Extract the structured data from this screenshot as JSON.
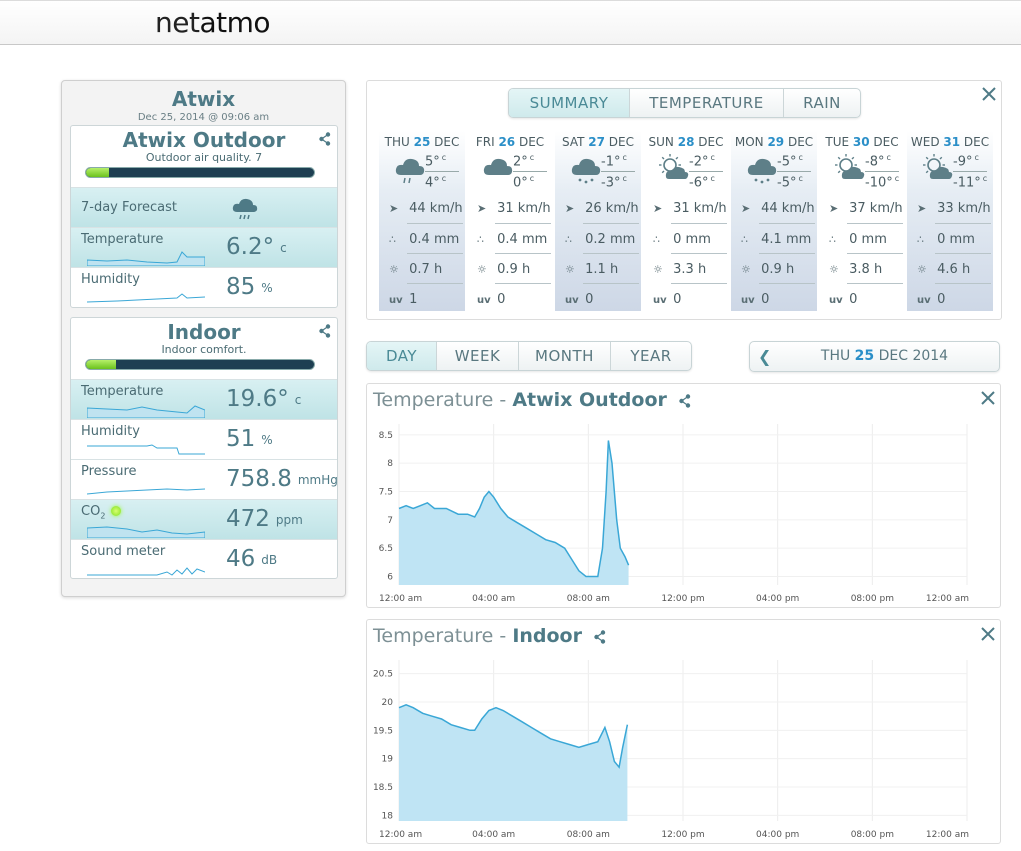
{
  "app": {
    "logo_light": "net",
    "logo_bold": "atmo"
  },
  "station": {
    "name": "Atwix",
    "date": "Dec 25, 2014 @ 09:06 am",
    "outdoor": {
      "title": "Atwix Outdoor",
      "subtitle": "Outdoor air quality. 7",
      "quality_fraction": 0.1,
      "rows": {
        "forecast": "7-day Forecast",
        "temperature": {
          "label": "Temperature",
          "value": "6.2°",
          "unit": "c"
        },
        "humidity": {
          "label": "Humidity",
          "value": "85",
          "unit": "%"
        }
      }
    },
    "indoor": {
      "title": "Indoor",
      "subtitle": "Indoor comfort.",
      "comfort_fraction": 0.13,
      "rows": {
        "temperature": {
          "label": "Temperature",
          "value": "19.6°",
          "unit": "c"
        },
        "humidity": {
          "label": "Humidity",
          "value": "51",
          "unit": "%"
        },
        "pressure": {
          "label": "Pressure",
          "value": "758.8",
          "unit": "mmHg"
        },
        "co2": {
          "label": "CO",
          "sub": "2",
          "value": "472",
          "unit": "ppm"
        },
        "sound": {
          "label": "Sound meter",
          "value": "46",
          "unit": "dB"
        }
      }
    }
  },
  "forecast": {
    "tabs": [
      "SUMMARY",
      "TEMPERATURE",
      "RAIN"
    ],
    "days": [
      {
        "dow": "THU",
        "num": "25",
        "mon": "DEC",
        "icon": "rain-icon",
        "max": "5°",
        "min": "4°",
        "wind": "44 km/h",
        "rain": "0.4 mm",
        "sun": "0.7 h",
        "uv": "1"
      },
      {
        "dow": "FRI",
        "num": "26",
        "mon": "DEC",
        "icon": "cloud-icon",
        "max": "2°",
        "min": "0°",
        "wind": "31 km/h",
        "rain": "0.4 mm",
        "sun": "0.9 h",
        "uv": "0"
      },
      {
        "dow": "SAT",
        "num": "27",
        "mon": "DEC",
        "icon": "snow-icon",
        "max": "-1°",
        "min": "-3°",
        "wind": "26 km/h",
        "rain": "0.2 mm",
        "sun": "1.1 h",
        "uv": "0"
      },
      {
        "dow": "SUN",
        "num": "28",
        "mon": "DEC",
        "icon": "sun-cloud-icon",
        "max": "-2°",
        "min": "-6°",
        "wind": "31 km/h",
        "rain": "0 mm",
        "sun": "3.3 h",
        "uv": "0"
      },
      {
        "dow": "MON",
        "num": "29",
        "mon": "DEC",
        "icon": "snow-icon",
        "max": "-5°",
        "min": "-5°",
        "wind": "44 km/h",
        "rain": "4.1 mm",
        "sun": "0.9 h",
        "uv": "0"
      },
      {
        "dow": "TUE",
        "num": "30",
        "mon": "DEC",
        "icon": "sun-cloud-icon",
        "max": "-8°",
        "min": "-10°",
        "wind": "37 km/h",
        "rain": "0 mm",
        "sun": "3.8 h",
        "uv": "0"
      },
      {
        "dow": "WED",
        "num": "31",
        "mon": "DEC",
        "icon": "sun-cloud-icon",
        "max": "-9°",
        "min": "-11°",
        "wind": "33 km/h",
        "rain": "0 mm",
        "sun": "4.6 h",
        "uv": "0"
      }
    ],
    "unit": "c",
    "uv_label": "uv"
  },
  "range": {
    "tabs": [
      "DAY",
      "WEEK",
      "MONTH",
      "YEAR"
    ],
    "date_pre": "THU",
    "date_num": "25",
    "date_post": "DEC 2014"
  },
  "chart_data": [
    {
      "type": "area",
      "title_prefix": "Temperature -",
      "title_bold": "Atwix Outdoor",
      "ylim": [
        5.85,
        8.55
      ],
      "yticks": [
        "8.5",
        "8",
        "7.5",
        "7",
        "6.5",
        "6"
      ],
      "ytick_values": [
        8.5,
        8,
        7.5,
        7,
        6.5,
        6
      ],
      "xticks": [
        "12:00 am",
        "04:00 am",
        "08:00 am",
        "12:00 pm",
        "04:00 pm",
        "08:00 pm",
        "12:00 am"
      ],
      "xlim": [
        0,
        24
      ],
      "points": [
        [
          0,
          7.2
        ],
        [
          0.3,
          7.25
        ],
        [
          0.6,
          7.2
        ],
        [
          0.9,
          7.25
        ],
        [
          1.2,
          7.3
        ],
        [
          1.5,
          7.2
        ],
        [
          2.0,
          7.2
        ],
        [
          2.5,
          7.1
        ],
        [
          2.9,
          7.1
        ],
        [
          3.2,
          7.05
        ],
        [
          3.4,
          7.2
        ],
        [
          3.6,
          7.4
        ],
        [
          3.8,
          7.5
        ],
        [
          4.0,
          7.4
        ],
        [
          4.3,
          7.2
        ],
        [
          4.6,
          7.05
        ],
        [
          5.0,
          6.95
        ],
        [
          5.4,
          6.85
        ],
        [
          5.8,
          6.75
        ],
        [
          6.2,
          6.65
        ],
        [
          6.6,
          6.6
        ],
        [
          7.0,
          6.5
        ],
        [
          7.3,
          6.3
        ],
        [
          7.6,
          6.1
        ],
        [
          7.9,
          6.0
        ],
        [
          8.4,
          6.0
        ],
        [
          8.6,
          6.5
        ],
        [
          8.75,
          7.5
        ],
        [
          8.85,
          8.4
        ],
        [
          9.0,
          8.0
        ],
        [
          9.2,
          7.0
        ],
        [
          9.35,
          6.5
        ],
        [
          9.55,
          6.35
        ],
        [
          9.7,
          6.2
        ]
      ]
    },
    {
      "type": "area",
      "title_prefix": "Temperature -",
      "title_bold": "Indoor",
      "ylim": [
        17.9,
        20.6
      ],
      "yticks": [
        "20.5",
        "20",
        "19.5",
        "19",
        "18.5",
        "18"
      ],
      "ytick_values": [
        20.5,
        20,
        19.5,
        19,
        18.5,
        18
      ],
      "xticks": [
        "12:00 am",
        "04:00 am",
        "08:00 am",
        "12:00 pm",
        "04:00 pm",
        "08:00 pm",
        "12:00 am"
      ],
      "xlim": [
        0,
        24
      ],
      "points": [
        [
          0,
          19.9
        ],
        [
          0.3,
          19.95
        ],
        [
          0.6,
          19.9
        ],
        [
          1.0,
          19.8
        ],
        [
          1.4,
          19.75
        ],
        [
          1.8,
          19.7
        ],
        [
          2.2,
          19.6
        ],
        [
          2.6,
          19.55
        ],
        [
          3.0,
          19.5
        ],
        [
          3.2,
          19.5
        ],
        [
          3.5,
          19.7
        ],
        [
          3.8,
          19.85
        ],
        [
          4.1,
          19.9
        ],
        [
          4.4,
          19.85
        ],
        [
          4.8,
          19.75
        ],
        [
          5.2,
          19.65
        ],
        [
          5.6,
          19.55
        ],
        [
          6.0,
          19.45
        ],
        [
          6.4,
          19.35
        ],
        [
          6.8,
          19.3
        ],
        [
          7.2,
          19.25
        ],
        [
          7.6,
          19.2
        ],
        [
          8.0,
          19.25
        ],
        [
          8.4,
          19.3
        ],
        [
          8.7,
          19.55
        ],
        [
          8.9,
          19.3
        ],
        [
          9.1,
          18.95
        ],
        [
          9.3,
          18.85
        ],
        [
          9.45,
          19.2
        ],
        [
          9.65,
          19.6
        ]
      ]
    }
  ]
}
